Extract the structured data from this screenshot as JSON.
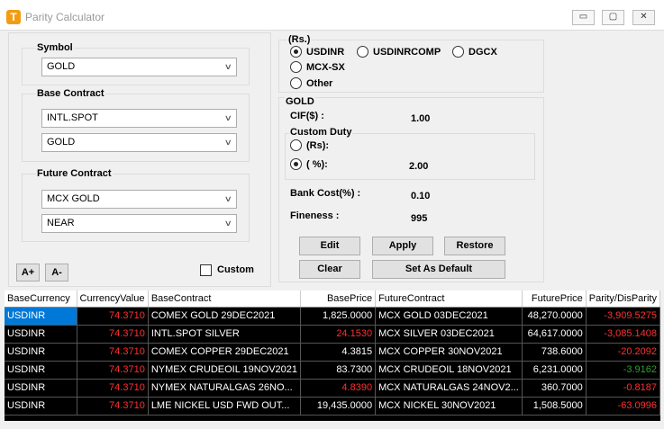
{
  "window": {
    "title": "Parity Calculator",
    "minimize": "▭",
    "maximize": "▢",
    "close": "✕",
    "icon": "T"
  },
  "symbol": {
    "label": "Symbol",
    "value": "GOLD"
  },
  "base_contract": {
    "label": "Base Contract",
    "value1": "INTL.SPOT",
    "value2": "GOLD"
  },
  "future_contract": {
    "label": "Future Contract",
    "value1": "MCX GOLD",
    "value2": "NEAR"
  },
  "font_buttons": {
    "increase": "A+",
    "decrease": "A-"
  },
  "custom_checkbox": {
    "label": "Custom",
    "checked": false
  },
  "currency": {
    "label": "(Rs.)",
    "options": [
      "USDINR",
      "USDINRCOMP",
      "DGCX",
      "MCX-SX",
      "Other"
    ],
    "selected": "USDINR"
  },
  "gold": {
    "label": "GOLD",
    "cif_label": "CIF($) :",
    "cif_value": "1.00",
    "custom_duty_label": "Custom Duty",
    "rs_option": "(Rs):",
    "pct_option": "( %):",
    "pct_value": "2.00",
    "bank_cost_label": "Bank Cost(%) :",
    "bank_cost_value": "0.10",
    "fineness_label": "Fineness :",
    "fineness_value": "995"
  },
  "buttons": {
    "edit": "Edit",
    "apply": "Apply",
    "restore": "Restore",
    "clear": "Clear",
    "set_default": "Set As Default"
  },
  "table": {
    "headers": [
      "BaseCurrency",
      "CurrencyValue",
      "BaseContract",
      "BasePrice",
      "FutureContract",
      "FuturePrice",
      "Parity/DisParity"
    ],
    "rows": [
      [
        "USDINR",
        "74.3710",
        "COMEX GOLD 29DEC2021",
        "1,825.0000",
        "MCX GOLD 03DEC2021",
        "48,270.0000",
        "-3,909.5275"
      ],
      [
        "USDINR",
        "74.3710",
        "INTL.SPOT SILVER",
        "24.1530",
        "MCX SILVER 03DEC2021",
        "64,617.0000",
        "-3,085.1408"
      ],
      [
        "USDINR",
        "74.3710",
        "COMEX COPPER 29DEC2021",
        "4.3815",
        "MCX COPPER 30NOV2021",
        "738.6000",
        "-20.2092"
      ],
      [
        "USDINR",
        "74.3710",
        "NYMEX CRUDEOIL 19NOV2021",
        "83.7300",
        "MCX CRUDEOIL 18NOV2021",
        "6,231.0000",
        "-3.9162"
      ],
      [
        "USDINR",
        "74.3710",
        "NYMEX NATURALGAS 26NO...",
        "4.8390",
        "MCX NATURALGAS 24NOV2...",
        "360.7000",
        "-0.8187"
      ],
      [
        "USDINR",
        "74.3710",
        "LME NICKEL USD FWD OUT...",
        "19,435.0000",
        "MCX NICKEL 30NOV2021",
        "1,508.5000",
        "-63.0996"
      ]
    ],
    "base_price_colors": [
      "white",
      "red",
      "white",
      "white",
      "red",
      "white"
    ],
    "parity_colors": [
      "red",
      "red",
      "red",
      "green",
      "red",
      "red"
    ]
  }
}
